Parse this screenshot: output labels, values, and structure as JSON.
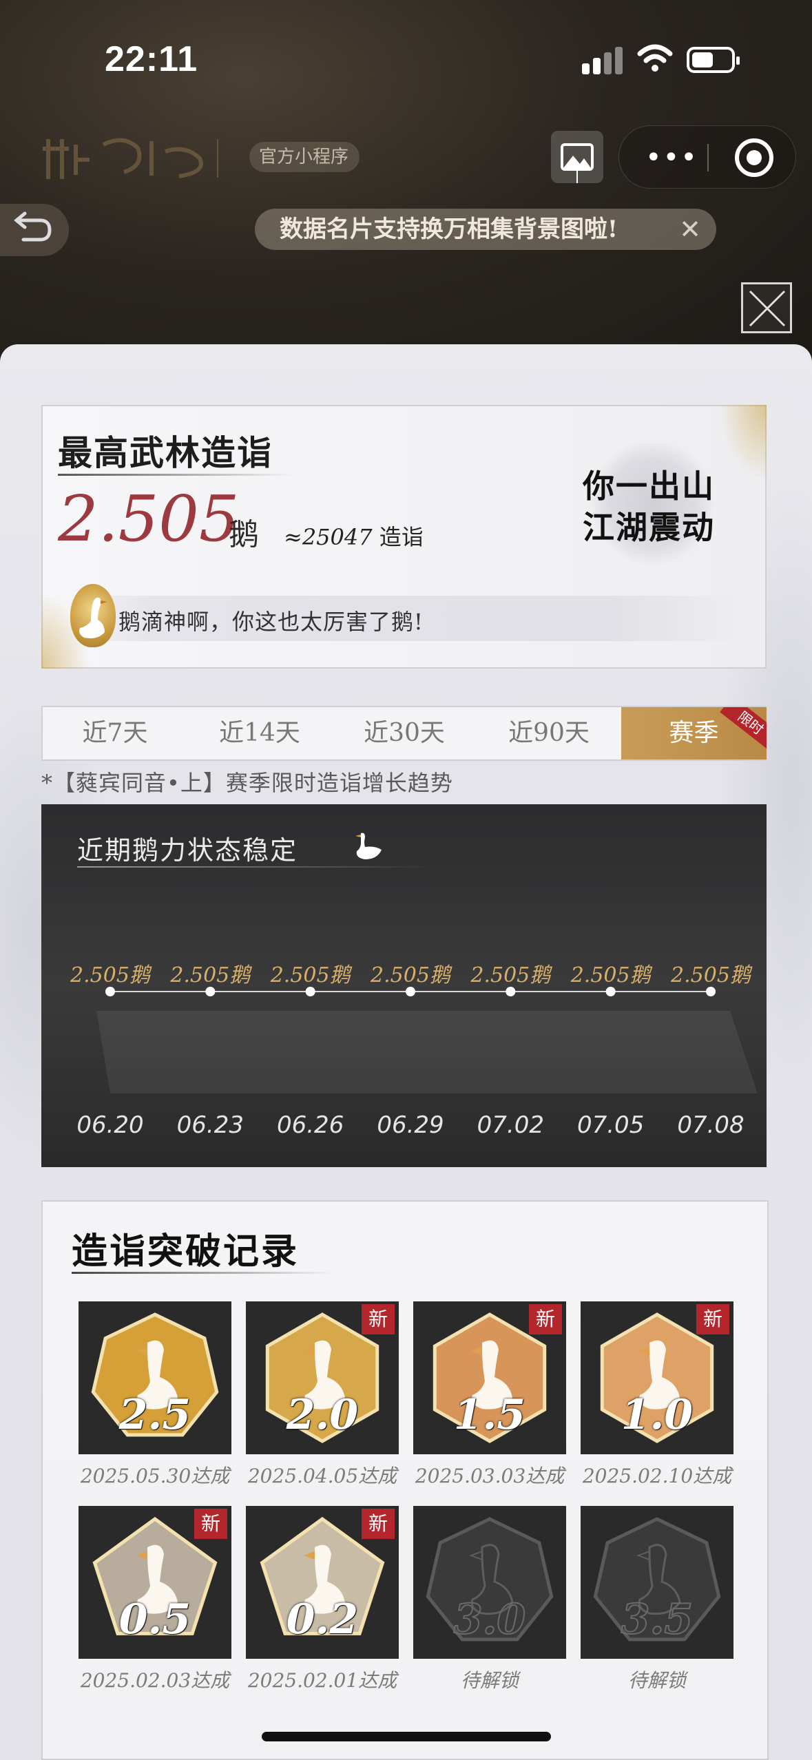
{
  "status_bar": {
    "time": "22:11"
  },
  "mini_program": {
    "badge": "官方小程序"
  },
  "toast": {
    "text": "数据名片支持换万相集背景图啦!",
    "close": "✕"
  },
  "card_highest": {
    "title": "最高武林造诣",
    "value": "2.505",
    "unit": "鹅",
    "approx_prefix": "≈",
    "approx_value": "25047",
    "approx_suffix": "造诣",
    "badge_line1": "你一出山",
    "badge_line2": "江湖震动",
    "message": "鹅滴神啊，你这也太厉害了鹅!"
  },
  "tabs": [
    {
      "label": "近7天"
    },
    {
      "label": "近14天"
    },
    {
      "label": "近30天"
    },
    {
      "label": "近90天"
    },
    {
      "label": "赛季",
      "badge": "限时",
      "active": true
    }
  ],
  "season_note": "*【蕤宾同音•上】赛季限时造诣增长趋势",
  "trend": {
    "title": "近期鹅力状态稳定"
  },
  "chart_data": {
    "type": "line",
    "categories": [
      "06.20",
      "06.23",
      "06.26",
      "06.29",
      "07.02",
      "07.05",
      "07.08"
    ],
    "series": [
      {
        "values": [
          2.505,
          2.505,
          2.505,
          2.505,
          2.505,
          2.505,
          2.505
        ]
      }
    ],
    "point_labels": [
      "2.505鹅",
      "2.505鹅",
      "2.505鹅",
      "2.505鹅",
      "2.505鹅",
      "2.505鹅",
      "2.505鹅"
    ],
    "colors": {
      "label": "#d9b06a",
      "line": "#d8d8d8",
      "point": "#ffffff"
    }
  },
  "records": {
    "title": "造诣突破记录",
    "items": [
      {
        "level": "2.5",
        "caption": "2025.05.30达成",
        "new": false,
        "locked": false,
        "color": "#d4a037"
      },
      {
        "level": "2.0",
        "caption": "2025.04.05达成",
        "new": true,
        "locked": false,
        "color": "#d6a84a"
      },
      {
        "level": "1.5",
        "caption": "2025.03.03达成",
        "new": true,
        "locked": false,
        "color": "#d7955a"
      },
      {
        "level": "1.0",
        "caption": "2025.02.10达成",
        "new": true,
        "locked": false,
        "color": "#dfa266"
      },
      {
        "level": "0.5",
        "caption": "2025.02.03达成",
        "new": true,
        "locked": false,
        "color": "#b8ad9c"
      },
      {
        "level": "0.2",
        "caption": "2025.02.01达成",
        "new": true,
        "locked": false,
        "color": "#c9bca6"
      },
      {
        "level": "3.0",
        "caption": "待解锁",
        "new": false,
        "locked": true,
        "color": "#3a3a3a"
      },
      {
        "level": "3.5",
        "caption": "待解锁",
        "new": false,
        "locked": true,
        "color": "#3a3a3a"
      }
    ],
    "new_label": "新"
  }
}
